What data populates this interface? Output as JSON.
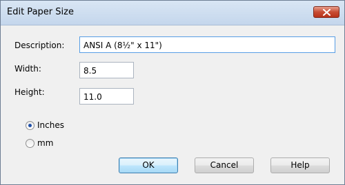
{
  "dialog": {
    "title": "Edit Paper Size"
  },
  "form": {
    "description_label": "Description:",
    "description_value": "ANSI A  (8½\" x 11\")",
    "width_label": "Width:",
    "width_value": "8.5",
    "height_label": "Height:",
    "height_value": "11.0"
  },
  "units": {
    "options": [
      "Inches",
      "mm"
    ],
    "selected": "Inches"
  },
  "buttons": {
    "ok": "OK",
    "cancel": "Cancel",
    "help": "Help"
  }
}
